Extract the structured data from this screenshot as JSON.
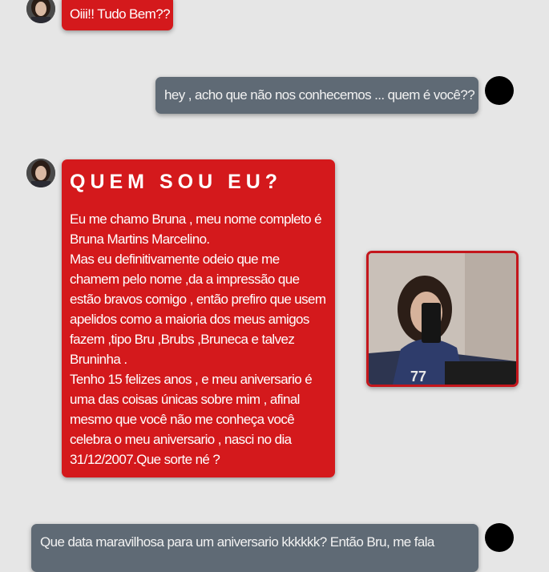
{
  "colors": {
    "background": "#e6e6e6",
    "red_bubble": "#d4191c",
    "gray_bubble": "#5f6a75",
    "user_avatar": "#000000"
  },
  "messages": [
    {
      "sender": "bruna",
      "avatar_icon": "profile-photo-icon",
      "text": "Oiii!! Tudo Bem??"
    },
    {
      "sender": "visitor",
      "avatar_icon": "black-circle-avatar",
      "text": "hey , acho que não nos conhecemos ... quem é você??"
    },
    {
      "sender": "bruna",
      "avatar_icon": "profile-photo-icon",
      "title": "QUEM SOU EU?",
      "paragraphs": [
        "Eu me chamo Bruna , meu nome completo é Bruna Martins Marcelino.",
        "Mas eu definitivamente odeio que me chamem pelo nome ,da a impressão que estão bravos comigo , então prefiro que usem apelidos como a maioria dos meus amigos fazem ,tipo Bru ,Brubs ,Bruneca e talvez Bruninha .",
        "Tenho 15 felizes anos , e meu aniversario é uma das coisas únicas sobre mim , afinal mesmo que você não me conheça você celebra o meu aniversario , nasci no dia 31/12/2007.Que sorte né ?"
      ],
      "photo_icon": "selfie-photo"
    },
    {
      "sender": "visitor",
      "avatar_icon": "black-circle-avatar",
      "text": "Que data maravilhosa para um aniversario kkkkkk? Então Bru, me fala"
    }
  ]
}
